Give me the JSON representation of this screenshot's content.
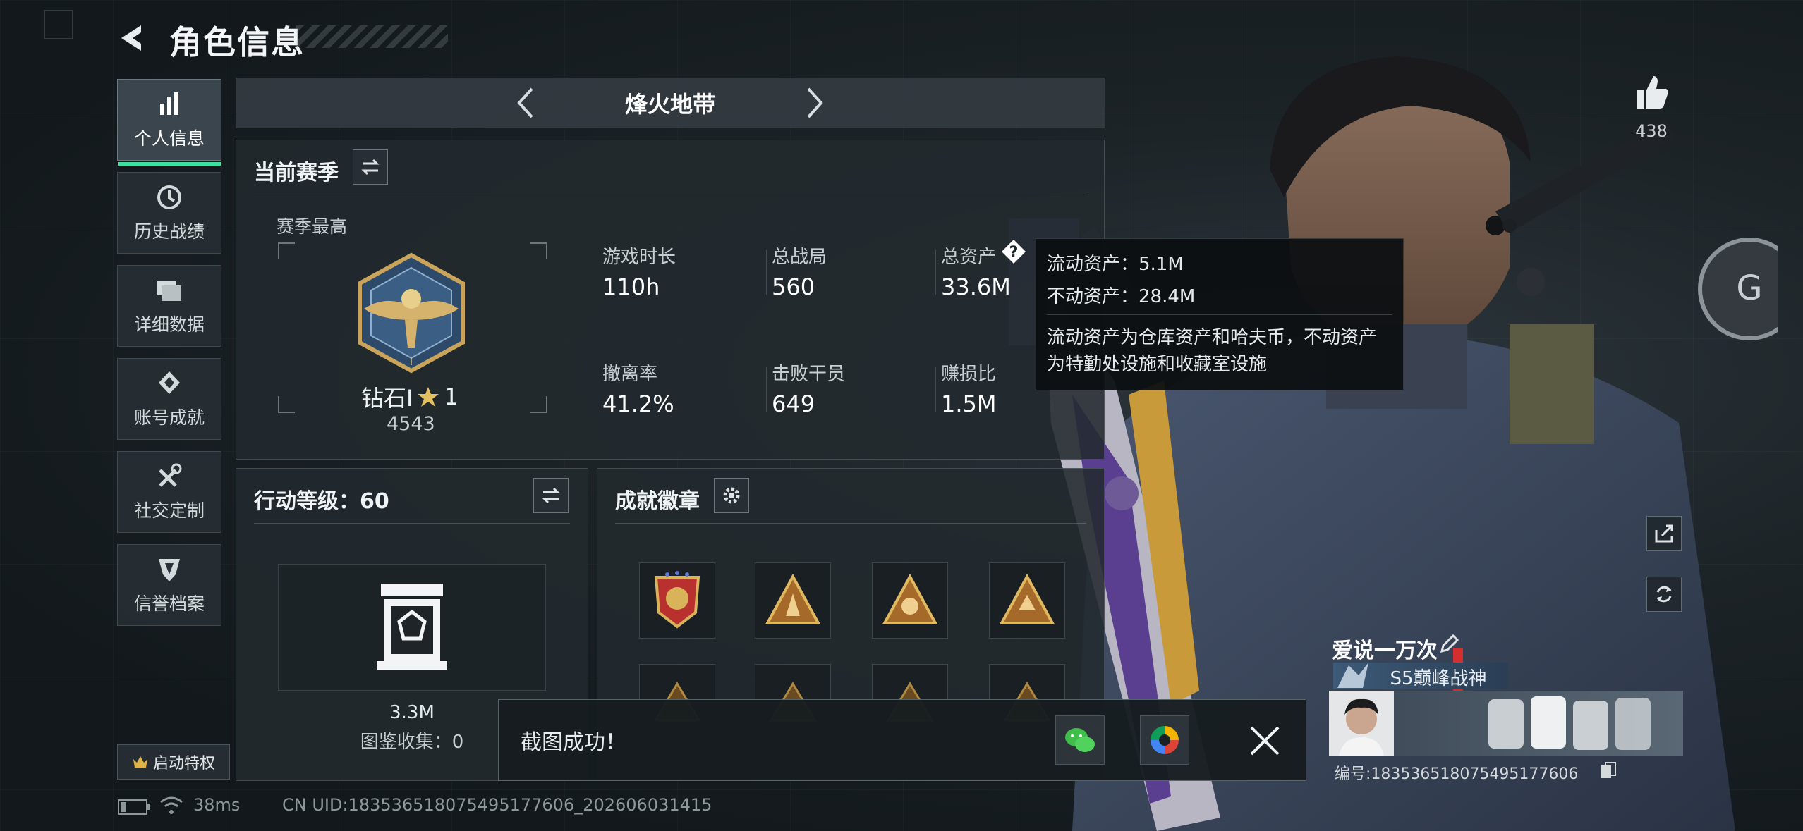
{
  "header": {
    "title": "角色信息"
  },
  "sidebar": {
    "items": [
      {
        "label": "个人信息",
        "icon": "bar-chart-icon",
        "active": true
      },
      {
        "label": "历史战绩",
        "icon": "clock-icon",
        "active": false
      },
      {
        "label": "详细数据",
        "icon": "folder-icon",
        "active": false
      },
      {
        "label": "账号成就",
        "icon": "badge-icon",
        "active": false
      },
      {
        "label": "社交定制",
        "icon": "tools-icon",
        "active": false
      },
      {
        "label": "信誉档案",
        "icon": "shield-icon",
        "active": false
      }
    ],
    "privilege_label": "启动特权"
  },
  "mode_selector": {
    "title": "烽火地带"
  },
  "season": {
    "title": "当前赛季",
    "best_label": "赛季最高",
    "rank_name": "钻石Ⅰ",
    "rank_stars": "1",
    "rank_points": "4543",
    "stats": [
      {
        "label": "游戏时长",
        "value": "110h"
      },
      {
        "label": "总战局",
        "value": "560"
      },
      {
        "label": "总资产",
        "value": "33.6M"
      },
      {
        "label": "撤离率",
        "value": "41.2%"
      },
      {
        "label": "击败干员",
        "value": "649"
      },
      {
        "label": "赚损比",
        "value": "1.5M"
      }
    ]
  },
  "tooltip": {
    "liquid": "流动资产：5.1M",
    "fixed": "不动资产：28.4M",
    "description_line1": "流动资产为仓库资产和哈夫币，不动资产",
    "description_line2": "为特勤处设施和收藏室设施"
  },
  "action_level": {
    "title": "行动等级：60",
    "value": "3.3M",
    "collection": "图鉴收集：0"
  },
  "achievements": {
    "title": "成就徽章"
  },
  "toast": {
    "message": "截图成功！"
  },
  "likes": {
    "count": "438"
  },
  "player": {
    "name": "爱说一万次",
    "title_badge": "S5巅峰战神",
    "id_line": "编号:1835365180754951776​06"
  },
  "status_bar": {
    "ping": "38ms",
    "uid": "CN UID:1835365180754951776​06_202606031415"
  },
  "colors": {
    "accent": "#3ee0a0",
    "gold": "#c9a45a"
  }
}
